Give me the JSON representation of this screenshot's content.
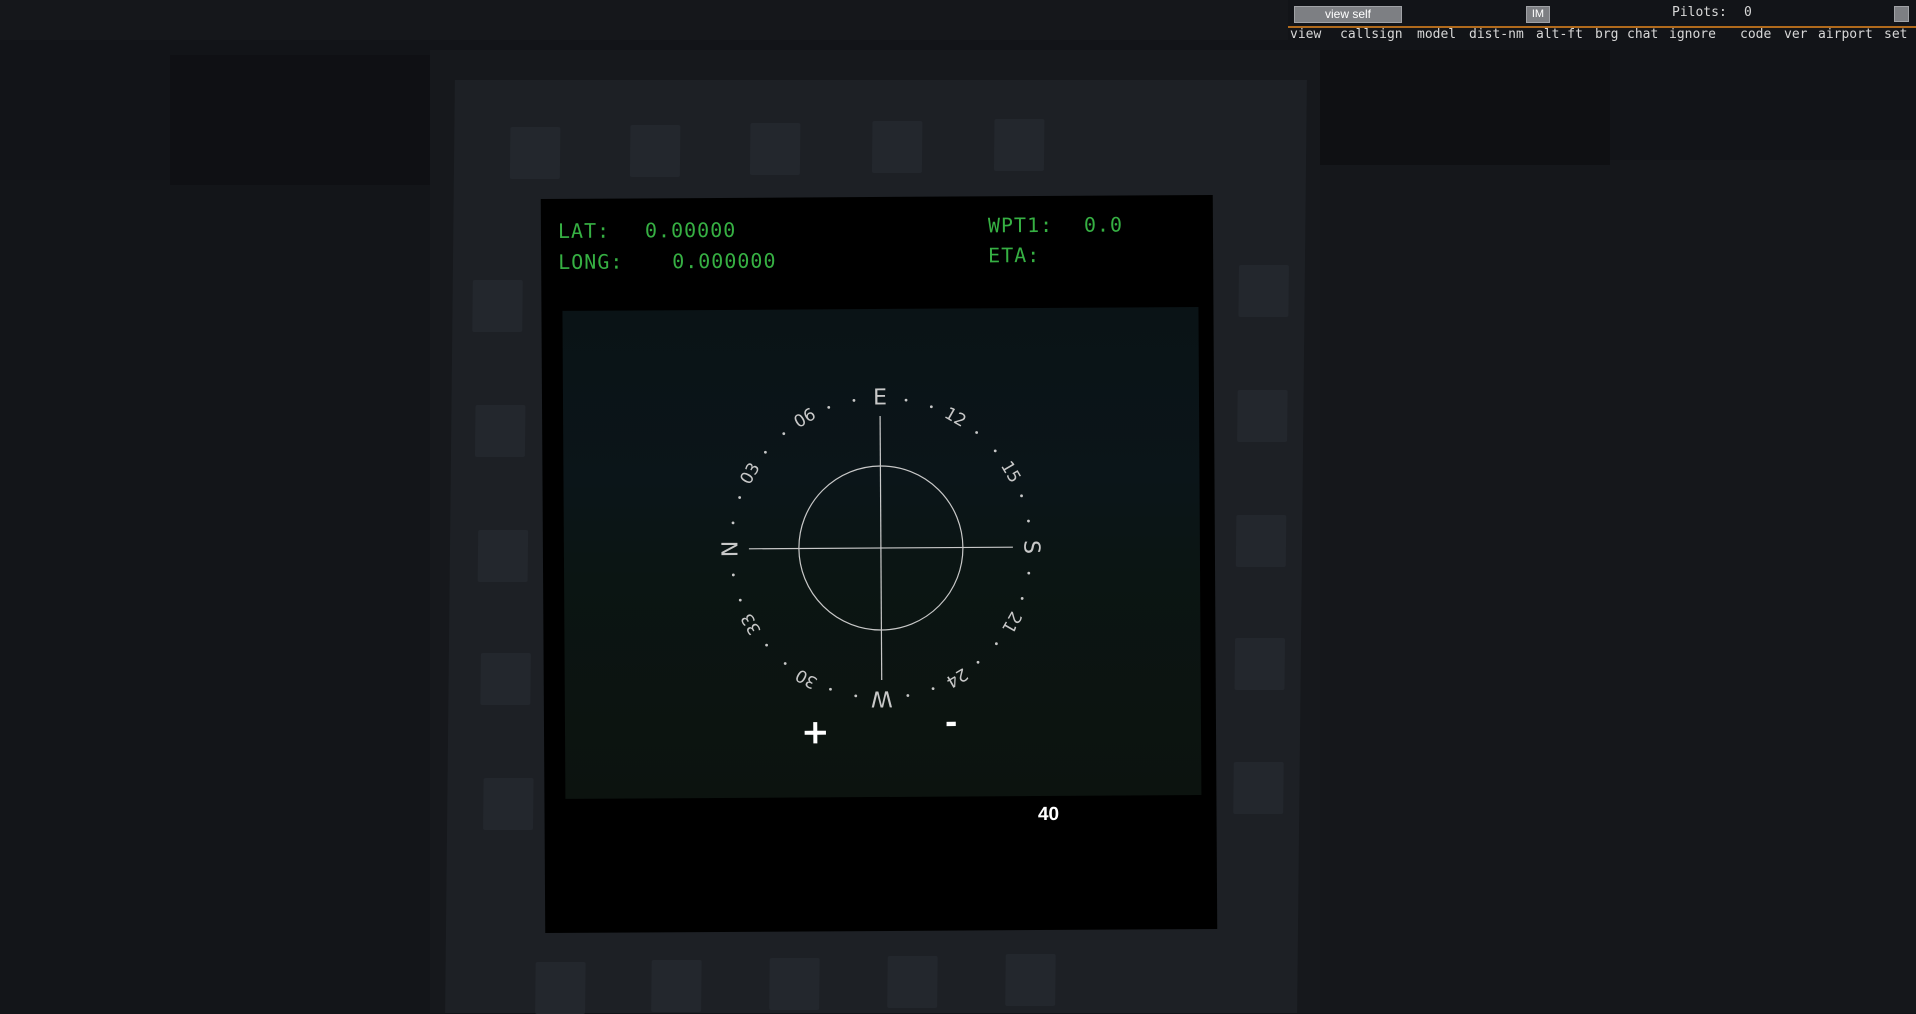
{
  "mfd": {
    "lat_label": "LAT:",
    "lat_value": "0.00000",
    "long_label": "LONG:",
    "long_value": "0.000000",
    "wpt_label": "WPT1:",
    "wpt_value": "0.0",
    "eta_label": "ETA:",
    "zoom_in_label": "+",
    "zoom_out_label": "-",
    "range_value": "40",
    "text_color": "#36b043"
  },
  "compass": {
    "cardinals": [
      "E",
      "S",
      "W",
      "N"
    ],
    "ticks": [
      "12",
      "15",
      "21",
      "24",
      "30",
      "33",
      "03",
      "06"
    ],
    "color": "#c8c8c8"
  },
  "multiplayer": {
    "view_self_label": "view self",
    "im_label": "IM",
    "pilots_label": "Pilots:",
    "pilots_count": "0",
    "columns": [
      "view",
      "callsign",
      "model",
      "dist-nm",
      "alt-ft",
      "brg",
      "chat",
      "ignore",
      "code",
      "ver",
      "airport",
      "set"
    ],
    "accent_color": "#b06a1c"
  }
}
